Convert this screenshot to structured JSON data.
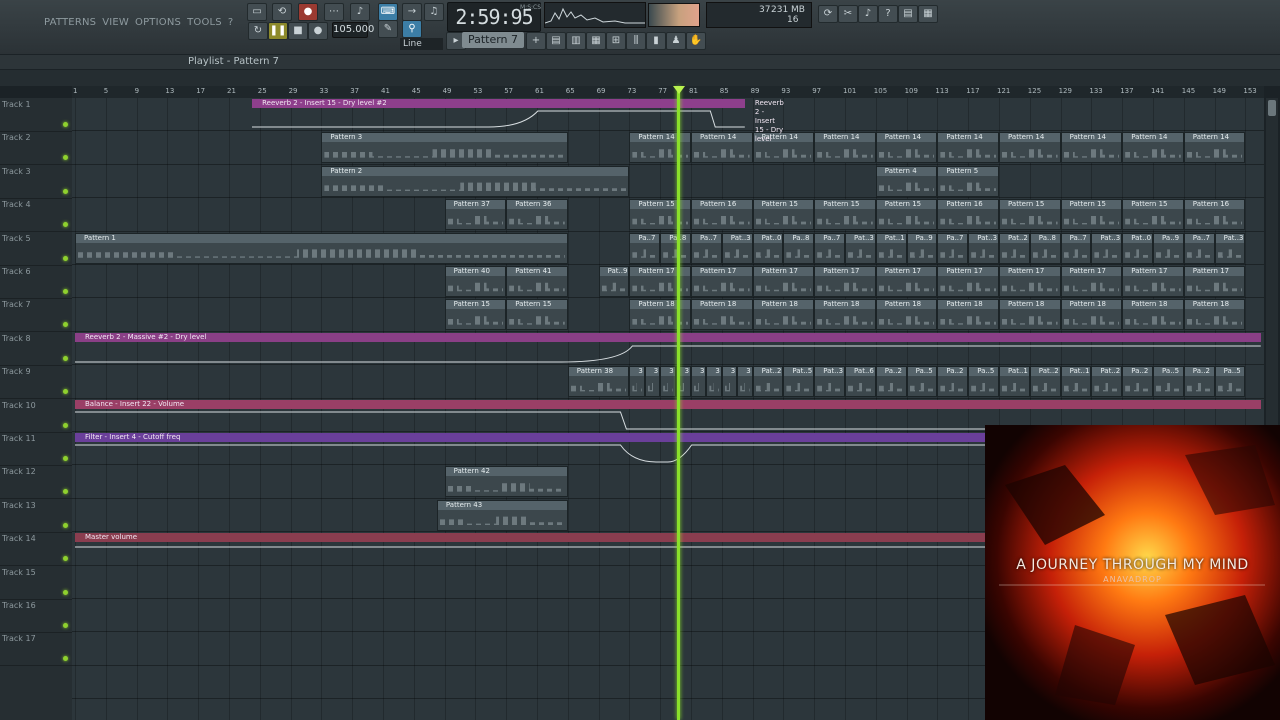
{
  "menu": [
    "PATTERNS",
    "VIEW",
    "OPTIONS",
    "TOOLS",
    "?"
  ],
  "transport": {
    "time": "2:59:95",
    "time_label": "M:S:CS",
    "tempo": "105.000",
    "snap": "Line",
    "pattern": "Pattern 7",
    "cpu": "37",
    "ram": "231 MB",
    "poly": "16"
  },
  "playlist": {
    "title": "Playlist - Pattern 7",
    "ruler": [
      "1",
      "5",
      "9",
      "13",
      "17",
      "21",
      "25",
      "29",
      "33",
      "37",
      "41",
      "45",
      "49",
      "53",
      "57",
      "61",
      "65",
      "69",
      "73",
      "77",
      "81",
      "85",
      "89",
      "93",
      "97",
      "101",
      "105",
      "109",
      "113",
      "117",
      "121",
      "125",
      "129",
      "133",
      "137",
      "141",
      "145",
      "149",
      "153"
    ],
    "tracks": [
      "Track 1",
      "Track 2",
      "Track 3",
      "Track 4",
      "Track 5",
      "Track 6",
      "Track 7",
      "Track 8",
      "Track 9",
      "Track 10",
      "Track 11",
      "Track 12",
      "Track 13",
      "Track 14",
      "Track 15",
      "Track 16",
      "Track 17"
    ]
  },
  "clips": [
    {
      "row": 1,
      "from": 33,
      "to": 65,
      "label": "Pattern 3"
    },
    {
      "row": 1,
      "from": 73,
      "to": 81,
      "label": "Pattern 14"
    },
    {
      "row": 1,
      "from": 81,
      "to": 89,
      "label": "Pattern 14"
    },
    {
      "row": 1,
      "from": 89,
      "to": 97,
      "label": "Pattern 14"
    },
    {
      "row": 1,
      "from": 97,
      "to": 105,
      "label": "Pattern 14"
    },
    {
      "row": 1,
      "from": 105,
      "to": 113,
      "label": "Pattern 14"
    },
    {
      "row": 1,
      "from": 113,
      "to": 121,
      "label": "Pattern 14"
    },
    {
      "row": 1,
      "from": 121,
      "to": 129,
      "label": "Pattern 14"
    },
    {
      "row": 1,
      "from": 129,
      "to": 137,
      "label": "Pattern 14"
    },
    {
      "row": 1,
      "from": 137,
      "to": 145,
      "label": "Pattern 14"
    },
    {
      "row": 1,
      "from": 145,
      "to": 153,
      "label": "Pattern 14"
    },
    {
      "row": 2,
      "from": 33,
      "to": 73,
      "label": "Pattern 2"
    },
    {
      "row": 2,
      "from": 105,
      "to": 113,
      "label": "Pattern 4"
    },
    {
      "row": 2,
      "from": 113,
      "to": 121,
      "label": "Pattern 5"
    },
    {
      "row": 3,
      "from": 49,
      "to": 57,
      "label": "Pattern 37"
    },
    {
      "row": 3,
      "from": 57,
      "to": 65,
      "label": "Pattern 36"
    },
    {
      "row": 3,
      "from": 73,
      "to": 81,
      "label": "Pattern 15"
    },
    {
      "row": 3,
      "from": 81,
      "to": 89,
      "label": "Pattern 16"
    },
    {
      "row": 3,
      "from": 89,
      "to": 97,
      "label": "Pattern 15"
    },
    {
      "row": 3,
      "from": 97,
      "to": 105,
      "label": "Pattern 15"
    },
    {
      "row": 3,
      "from": 105,
      "to": 113,
      "label": "Pattern 15"
    },
    {
      "row": 3,
      "from": 113,
      "to": 121,
      "label": "Pattern 16"
    },
    {
      "row": 3,
      "from": 121,
      "to": 129,
      "label": "Pattern 15"
    },
    {
      "row": 3,
      "from": 129,
      "to": 137,
      "label": "Pattern 15"
    },
    {
      "row": 3,
      "from": 137,
      "to": 145,
      "label": "Pattern 15"
    },
    {
      "row": 3,
      "from": 145,
      "to": 153,
      "label": "Pattern 16"
    },
    {
      "row": 4,
      "from": 1,
      "to": 65,
      "label": "Pattern 1"
    },
    {
      "row": 4,
      "from": 73,
      "to": 77,
      "label": "Pa..7"
    },
    {
      "row": 4,
      "from": 77,
      "to": 81,
      "label": "Pa..8"
    },
    {
      "row": 4,
      "from": 81,
      "to": 85,
      "label": "Pa..7"
    },
    {
      "row": 4,
      "from": 85,
      "to": 89,
      "label": "Pat..3"
    },
    {
      "row": 4,
      "from": 89,
      "to": 93,
      "label": "Pat..0"
    },
    {
      "row": 4,
      "from": 93,
      "to": 97,
      "label": "Pa..8"
    },
    {
      "row": 4,
      "from": 97,
      "to": 101,
      "label": "Pa..7"
    },
    {
      "row": 4,
      "from": 101,
      "to": 105,
      "label": "Pat..3"
    },
    {
      "row": 4,
      "from": 105,
      "to": 109,
      "label": "Pat..1"
    },
    {
      "row": 4,
      "from": 109,
      "to": 113,
      "label": "Pa..9"
    },
    {
      "row": 4,
      "from": 113,
      "to": 117,
      "label": "Pa..7"
    },
    {
      "row": 4,
      "from": 117,
      "to": 121,
      "label": "Pat..3"
    },
    {
      "row": 4,
      "from": 121,
      "to": 125,
      "label": "Pat..2"
    },
    {
      "row": 4,
      "from": 125,
      "to": 129,
      "label": "Pa..8"
    },
    {
      "row": 4,
      "from": 129,
      "to": 133,
      "label": "Pa..7"
    },
    {
      "row": 4,
      "from": 133,
      "to": 137,
      "label": "Pat..3"
    },
    {
      "row": 4,
      "from": 137,
      "to": 141,
      "label": "Pat..0"
    },
    {
      "row": 4,
      "from": 141,
      "to": 145,
      "label": "Pa..9"
    },
    {
      "row": 4,
      "from": 145,
      "to": 149,
      "label": "Pa..7"
    },
    {
      "row": 4,
      "from": 149,
      "to": 153,
      "label": "Pat..3"
    },
    {
      "row": 5,
      "from": 49,
      "to": 57,
      "label": "Pattern 40"
    },
    {
      "row": 5,
      "from": 57,
      "to": 65,
      "label": "Pattern 41"
    },
    {
      "row": 5,
      "from": 69,
      "to": 73,
      "label": "Pat..9"
    },
    {
      "row": 5,
      "from": 73,
      "to": 81,
      "label": "Pattern 17"
    },
    {
      "row": 5,
      "from": 81,
      "to": 89,
      "label": "Pattern 17"
    },
    {
      "row": 5,
      "from": 89,
      "to": 97,
      "label": "Pattern 17"
    },
    {
      "row": 5,
      "from": 97,
      "to": 105,
      "label": "Pattern 17"
    },
    {
      "row": 5,
      "from": 105,
      "to": 113,
      "label": "Pattern 17"
    },
    {
      "row": 5,
      "from": 113,
      "to": 121,
      "label": "Pattern 17"
    },
    {
      "row": 5,
      "from": 121,
      "to": 129,
      "label": "Pattern 17"
    },
    {
      "row": 5,
      "from": 129,
      "to": 137,
      "label": "Pattern 17"
    },
    {
      "row": 5,
      "from": 137,
      "to": 145,
      "label": "Pattern 17"
    },
    {
      "row": 5,
      "from": 145,
      "to": 153,
      "label": "Pattern 17"
    },
    {
      "row": 6,
      "from": 49,
      "to": 57,
      "label": "Pattern 15"
    },
    {
      "row": 6,
      "from": 57,
      "to": 65,
      "label": "Pattern 15"
    },
    {
      "row": 6,
      "from": 73,
      "to": 81,
      "label": "Pattern 18"
    },
    {
      "row": 6,
      "from": 81,
      "to": 89,
      "label": "Pattern 18"
    },
    {
      "row": 6,
      "from": 89,
      "to": 97,
      "label": "Pattern 18"
    },
    {
      "row": 6,
      "from": 97,
      "to": 105,
      "label": "Pattern 18"
    },
    {
      "row": 6,
      "from": 105,
      "to": 113,
      "label": "Pattern 18"
    },
    {
      "row": 6,
      "from": 113,
      "to": 121,
      "label": "Pattern 18"
    },
    {
      "row": 6,
      "from": 121,
      "to": 129,
      "label": "Pattern 18"
    },
    {
      "row": 6,
      "from": 129,
      "to": 137,
      "label": "Pattern 18"
    },
    {
      "row": 6,
      "from": 137,
      "to": 145,
      "label": "Pattern 18"
    },
    {
      "row": 6,
      "from": 145,
      "to": 153,
      "label": "Pattern 18"
    },
    {
      "row": 8,
      "from": 65,
      "to": 73,
      "label": "Pattern 38"
    },
    {
      "row": 8,
      "from": 73,
      "to": 75,
      "label": "3"
    },
    {
      "row": 8,
      "from": 75,
      "to": 77,
      "label": "3"
    },
    {
      "row": 8,
      "from": 77,
      "to": 79,
      "label": "3"
    },
    {
      "row": 8,
      "from": 79,
      "to": 81,
      "label": "3"
    },
    {
      "row": 8,
      "from": 81,
      "to": 83,
      "label": "3"
    },
    {
      "row": 8,
      "from": 83,
      "to": 85,
      "label": "3"
    },
    {
      "row": 8,
      "from": 85,
      "to": 87,
      "label": "3"
    },
    {
      "row": 8,
      "from": 87,
      "to": 89,
      "label": "3"
    },
    {
      "row": 8,
      "from": 89,
      "to": 93,
      "label": "Pat..2"
    },
    {
      "row": 8,
      "from": 93,
      "to": 97,
      "label": "Pat..5"
    },
    {
      "row": 8,
      "from": 97,
      "to": 101,
      "label": "Pat..3"
    },
    {
      "row": 8,
      "from": 101,
      "to": 105,
      "label": "Pat..6"
    },
    {
      "row": 8,
      "from": 105,
      "to": 109,
      "label": "Pa..2"
    },
    {
      "row": 8,
      "from": 109,
      "to": 113,
      "label": "Pa..5"
    },
    {
      "row": 8,
      "from": 113,
      "to": 117,
      "label": "Pa..2"
    },
    {
      "row": 8,
      "from": 117,
      "to": 121,
      "label": "Pa..5"
    },
    {
      "row": 8,
      "from": 121,
      "to": 125,
      "label": "Pat..1"
    },
    {
      "row": 8,
      "from": 125,
      "to": 129,
      "label": "Pat..2"
    },
    {
      "row": 8,
      "from": 129,
      "to": 133,
      "label": "Pat..1"
    },
    {
      "row": 8,
      "from": 133,
      "to": 137,
      "label": "Pat..2"
    },
    {
      "row": 8,
      "from": 137,
      "to": 141,
      "label": "Pa..2"
    },
    {
      "row": 8,
      "from": 141,
      "to": 145,
      "label": "Pa..5"
    },
    {
      "row": 8,
      "from": 145,
      "to": 149,
      "label": "Pa..2"
    },
    {
      "row": 8,
      "from": 149,
      "to": 153,
      "label": "Pa..5"
    },
    {
      "row": 11,
      "from": 49,
      "to": 65,
      "label": "Pattern 42"
    },
    {
      "row": 12,
      "from": 48,
      "to": 65,
      "label": "Pattern 43"
    }
  ],
  "automation": [
    {
      "row": 0,
      "from": 24,
      "to": 88,
      "label": "Reeverb 2 - Insert 15 - Dry level #2",
      "color": "#8e3f8c",
      "label2_at": 88,
      "label2": "Reeverb 2 - Insert 15 - Dry level"
    },
    {
      "row": 7,
      "from": 1,
      "to": 155,
      "label": "Reeverb 2 - Massive #2 - Dry level",
      "color": "#8a3f86"
    },
    {
      "row": 9,
      "from": 1,
      "to": 155,
      "label": "Balance - Insert 22 - Volume",
      "color": "#9a3f66"
    },
    {
      "row": 10,
      "from": 1,
      "to": 155,
      "label": "Filter - Insert 4 - Cutoff freq",
      "color": "#6a3f9a"
    },
    {
      "row": 13,
      "from": 1,
      "to": 155,
      "label": "Master volume",
      "color": "#8a3d4f"
    }
  ],
  "album": {
    "title": "A JOURNEY THROUGH MY MIND",
    "artist": "ANAVADROP"
  },
  "colors": {
    "playhead": "#8ae02b",
    "clip_bg": "#3c474c",
    "clip_header": "#55636a",
    "track_led": "#8fd12e"
  }
}
